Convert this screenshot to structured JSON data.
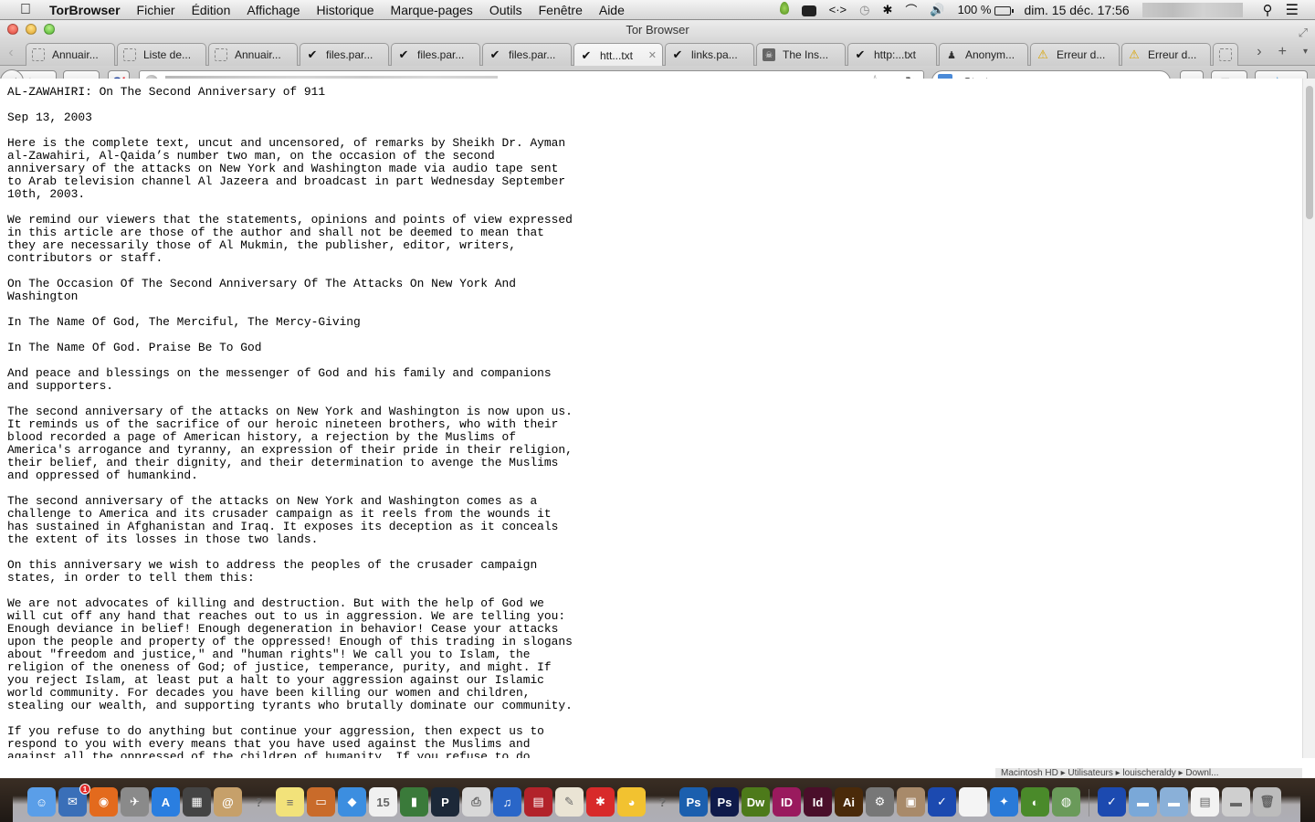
{
  "menubar": {
    "apple_icon": "apple-logo",
    "app_name": "TorBrowser",
    "menus": [
      "Fichier",
      "Édition",
      "Affichage",
      "Historique",
      "Marque-pages",
      "Outils",
      "Fenêtre",
      "Aide"
    ],
    "status": {
      "battery": "100 %",
      "clock": "dim. 15 déc.  17:56"
    },
    "icons": [
      "growl-leaf-icon",
      "keyboard-icon",
      "code-arrows-icon",
      "time-machine-icon",
      "bluetooth-icon",
      "wifi-icon",
      "volume-icon",
      "battery-icon",
      "spotlight-icon",
      "notification-center-icon"
    ]
  },
  "window": {
    "title": "Tor Browser"
  },
  "tabs": [
    {
      "label": "Annuair...",
      "icon": "blank",
      "active": false
    },
    {
      "label": "Liste de...",
      "icon": "blank",
      "active": false
    },
    {
      "label": "Annuair...",
      "icon": "blank",
      "active": false
    },
    {
      "label": "files.par...",
      "icon": "check",
      "active": false
    },
    {
      "label": "files.par...",
      "icon": "check",
      "active": false
    },
    {
      "label": "files.par...",
      "icon": "check",
      "active": false
    },
    {
      "label": "htt...txt",
      "icon": "check",
      "active": true
    },
    {
      "label": "links.pa...",
      "icon": "check",
      "active": false
    },
    {
      "label": "The Ins...",
      "icon": "pirate",
      "active": false
    },
    {
      "label": "http:...txt",
      "icon": "check",
      "active": false
    },
    {
      "label": "Anonym...",
      "icon": "anon",
      "active": false
    },
    {
      "label": "Erreur d...",
      "icon": "warn",
      "active": false
    },
    {
      "label": "Erreur d...",
      "icon": "warn",
      "active": false
    },
    {
      "label": "",
      "icon": "blank",
      "active": false
    }
  ],
  "tab_controls": {
    "scroll_left": "‹",
    "scroll_right": "›",
    "new_tab": "+",
    "list_all": "▾"
  },
  "navbar": {
    "back": "◀",
    "forward": "▶",
    "tor_button_caret": "▾",
    "startpage_s": "S",
    "startpage_bang": "!",
    "url": "",
    "bookmark_star": "☆",
    "url_dropdown": "▿",
    "reload": "↻",
    "search_engine": "Startpage",
    "search_engine_caret": "▾",
    "search_icon": "⌕",
    "home": "⌂",
    "bookmarks_caret": "▾",
    "addon_caret": "▾"
  },
  "document": {
    "lines": [
      "AL-ZAWAHIRI: On The Second Anniversary of 911",
      "",
      "Sep 13, 2003",
      "",
      "Here is the complete text, uncut and uncensored, of remarks by Sheikh Dr. Ayman",
      "al-Zawahiri, Al-Qaida’s number two man, on the occasion of the second",
      "anniversary of the attacks on New York and Washington made via audio tape sent",
      "to Arab television channel Al Jazeera and broadcast in part Wednesday September",
      "10th, 2003.",
      "",
      "We remind our viewers that the statements, opinions and points of view expressed",
      "in this article are those of the author and shall not be deemed to mean that",
      "they are necessarily those of Al Mukmin, the publisher, editor, writers,",
      "contributors or staff.",
      "",
      "On The Occasion Of The Second Anniversary Of The Attacks On New York And",
      "Washington",
      "",
      "In The Name Of God, The Merciful, The Mercy-Giving",
      "",
      "In The Name Of God. Praise Be To God",
      "",
      "And peace and blessings on the messenger of God and his family and companions",
      "and supporters.",
      "",
      "The second anniversary of the attacks on New York and Washington is now upon us.",
      "It reminds us of the sacrifice of our heroic nineteen brothers, who with their",
      "blood recorded a page of American history, a rejection by the Muslims of",
      "America's arrogance and tyranny, an expression of their pride in their religion,",
      "their belief, and their dignity, and their determination to avenge the Muslims",
      "and oppressed of humankind.",
      "",
      "The second anniversary of the attacks on New York and Washington comes as a",
      "challenge to America and its crusader campaign as it reels from the wounds it",
      "has sustained in Afghanistan and Iraq. It exposes its deception as it conceals",
      "the extent of its losses in those two lands.",
      "",
      "On this anniversary we wish to address the peoples of the crusader campaign",
      "states, in order to tell them this:",
      "",
      "We are not advocates of killing and destruction. But with the help of God we",
      "will cut off any hand that reaches out to us in aggression. We are telling you:",
      "Enough deviance in belief! Enough degeneration in behavior! Cease your attacks",
      "upon the people and property of the oppressed! Enough of this trading in slogans",
      "about \"freedom and justice,\" and \"human rights\"! We call you to Islam, the",
      "religion of the oneness of God; of justice, temperance, purity, and might. If",
      "you reject Islam, at least put a halt to your aggression against our Islamic",
      "world community. For decades you have been killing our women and children,",
      "stealing our wealth, and supporting tyrants who brutally dominate our community.",
      "",
      "If you refuse to do anything but continue your aggression, then expect us to",
      "respond to you with every means that you have used against the Muslims and",
      "against all the oppressed of the children of humanity. If you refuse to do"
    ]
  },
  "scroll": {
    "position_fraction": 0.0,
    "visible_fraction": 0.2
  },
  "dock": {
    "apps": [
      {
        "name": "finder",
        "glyph": "☺",
        "color": "#5a9ee8"
      },
      {
        "name": "thunderbird",
        "glyph": "✉",
        "color": "#3a6fb8",
        "badge": "1"
      },
      {
        "name": "firefox",
        "glyph": "◉",
        "color": "#e36a1d"
      },
      {
        "name": "launchpad",
        "glyph": "✈",
        "color": "#8a8a8a"
      },
      {
        "name": "app-store",
        "glyph": "A",
        "color": "#2a7ee0"
      },
      {
        "name": "mission-control",
        "glyph": "▦",
        "color": "#444"
      },
      {
        "name": "address-book",
        "glyph": "@",
        "color": "#c6a06a"
      },
      {
        "name": "unknown-app",
        "glyph": "?",
        "color": "transparent"
      },
      {
        "name": "stickies",
        "glyph": "≡",
        "color": "#f2e27a"
      },
      {
        "name": "keynote",
        "glyph": "▭",
        "color": "#c96b2a"
      },
      {
        "name": "dropbox",
        "glyph": "◆",
        "color": "#3c8ee0"
      },
      {
        "name": "calendar",
        "glyph": "15",
        "color": "#f0f0f0"
      },
      {
        "name": "numbers",
        "glyph": "▮",
        "color": "#3a7a3a"
      },
      {
        "name": "plex",
        "glyph": "P",
        "color": "#1c2838"
      },
      {
        "name": "printer",
        "glyph": "⎙",
        "color": "#d8d8d8"
      },
      {
        "name": "itunes",
        "glyph": "♫",
        "color": "#2a66c8"
      },
      {
        "name": "photo-booth",
        "glyph": "▤",
        "color": "#b2222a"
      },
      {
        "name": "textedit",
        "glyph": "✎",
        "color": "#eae4d4"
      },
      {
        "name": "tomato-timer",
        "glyph": "✱",
        "color": "#d82a2a"
      },
      {
        "name": "cyberduck",
        "glyph": "◕",
        "color": "#f2c230"
      },
      {
        "name": "unknown-app-2",
        "glyph": "?",
        "color": "transparent"
      },
      {
        "name": "photoshop",
        "glyph": "Ps",
        "color": "#1b5fae"
      },
      {
        "name": "photoshop-cs6",
        "glyph": "Ps",
        "color": "#0f1a4a"
      },
      {
        "name": "dreamweaver",
        "glyph": "Dw",
        "color": "#4d7a1a"
      },
      {
        "name": "indesign",
        "glyph": "ID",
        "color": "#9a1a5e"
      },
      {
        "name": "indesign-cs6",
        "glyph": "Id",
        "color": "#4a0f2a"
      },
      {
        "name": "illustrator",
        "glyph": "Ai",
        "color": "#4a2a0a"
      },
      {
        "name": "automator",
        "glyph": "⚙",
        "color": "#777"
      },
      {
        "name": "iphoto",
        "glyph": "▣",
        "color": "#a88a6a"
      },
      {
        "name": "vuze",
        "glyph": "✓",
        "color": "#1c4ab0"
      },
      {
        "name": "blank-document",
        "glyph": "",
        "color": "#f4f4f4"
      },
      {
        "name": "safari",
        "glyph": "✦",
        "color": "#2a7ad8"
      },
      {
        "name": "tor-onion",
        "glyph": "◐",
        "color": "#4a8a2a"
      },
      {
        "name": "tor-globe",
        "glyph": "◍",
        "color": "#6a9a5a"
      }
    ],
    "stacks": [
      {
        "name": "vuze-stack",
        "glyph": "✓",
        "color": "#1c4ab0"
      },
      {
        "name": "applications-folder",
        "glyph": "▬",
        "color": "#7aa8d8"
      },
      {
        "name": "documents-folder",
        "glyph": "▬",
        "color": "#8ab0d8"
      },
      {
        "name": "screenshots-stack",
        "glyph": "▤",
        "color": "#f2f2f2"
      },
      {
        "name": "downloads-stack",
        "glyph": "▬",
        "color": "#cfcfcf"
      },
      {
        "name": "trash",
        "glyph": "🗑",
        "color": "#bcbcbc"
      }
    ],
    "folder_path_strip": "Macintosh HD ▸ Utilisateurs ▸ louischeraldy ▸ Downl..."
  }
}
